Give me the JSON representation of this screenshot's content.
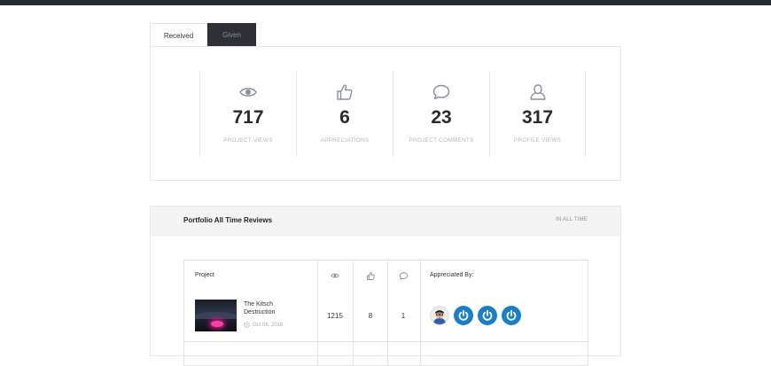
{
  "tabs": [
    {
      "label": "Received",
      "active": true
    },
    {
      "label": "Given",
      "active": false
    }
  ],
  "stats": [
    {
      "icon": "eye-icon",
      "value": "717",
      "label": "PROJECT VIEWS"
    },
    {
      "icon": "thumbs-up-icon",
      "value": "6",
      "label": "APPRECIATIONS"
    },
    {
      "icon": "comment-icon",
      "value": "23",
      "label": "PROJECT COMMENTS"
    },
    {
      "icon": "user-icon",
      "value": "317",
      "label": "PROFILE VIEWS"
    }
  ],
  "reviews": {
    "title": "Portfolio All Time Reviews",
    "range": "IN ALL TIME",
    "columns": {
      "project": "Project",
      "views_icon": "eye-icon",
      "appreciations_icon": "thumbs-up-icon",
      "comments_icon": "comment-icon",
      "appreciated_by": "Appreciated By:"
    },
    "rows": [
      {
        "title": "The Kitsch Destruction",
        "date": "Oct 06, 2016",
        "views": "1215",
        "appreciations": "8",
        "comments": "1",
        "appreciated_by": [
          "user-avatar",
          "power-icon",
          "power-icon",
          "power-icon"
        ]
      }
    ]
  },
  "colors": {
    "topbar": "#262a33",
    "active_tab_dark": "#2e3038",
    "power_blue": "#1b7fc7",
    "icon_gray": "#8a8f9e"
  }
}
